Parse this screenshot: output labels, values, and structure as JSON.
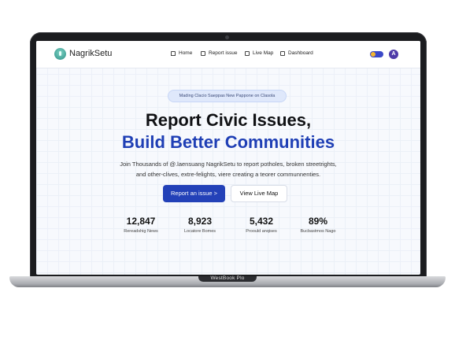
{
  "brand": "NagrikSetu",
  "nav": {
    "home": "Home",
    "report": "Report issue",
    "live_map": "Live Map",
    "dashboard": "Dashboard",
    "avatar_initial": "A"
  },
  "banner": "Mading Clacio Saeppas New Pappone on Clasola",
  "hero": {
    "line1": "Report Civic Issues,",
    "line2": "Build Better Communities",
    "sub1": "Join Thousands of @.laensuang NagrikSetu to report potholes, broken streetrights,",
    "sub2": "and other-clives, extre-felights, viere creating a teorer communnenties."
  },
  "buttons": {
    "primary": "Report an issue >",
    "secondary": "View Live Map"
  },
  "stats": [
    {
      "value": "12,847",
      "label": "Rereadshig News"
    },
    {
      "value": "8,923",
      "label": "Locatore Bomes"
    },
    {
      "value": "5,432",
      "label": "Proould anqises"
    },
    {
      "value": "89%",
      "label": "Bucbastmos Nago"
    }
  ],
  "device_label": "WestBook Plo",
  "colors": {
    "accent": "#1f3fb5",
    "button": "#2341b8",
    "toggle": "#3b49c8",
    "avatar": "#4e3aa8"
  }
}
